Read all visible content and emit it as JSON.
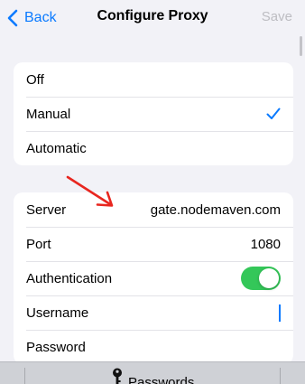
{
  "nav": {
    "back_label": "Back",
    "title": "Configure Proxy",
    "save_label": "Save",
    "accent": "#0a7aff",
    "disabled_color": "#bdbdc2"
  },
  "proxy_mode": {
    "options": [
      "Off",
      "Manual",
      "Automatic"
    ],
    "selected": "Manual"
  },
  "settings": {
    "server_label": "Server",
    "server_value": "gate.nodemaven.com",
    "port_label": "Port",
    "port_value": "1080",
    "auth_label": "Authentication",
    "auth_enabled": true,
    "username_label": "Username",
    "username_value": "",
    "password_label": "Password",
    "password_value": ""
  },
  "toggle_color": "#34c759",
  "annotation_arrow_color": "#e8261f",
  "bottom_bar": {
    "passwords_label": "Passwords",
    "key_icon": "key-icon"
  }
}
